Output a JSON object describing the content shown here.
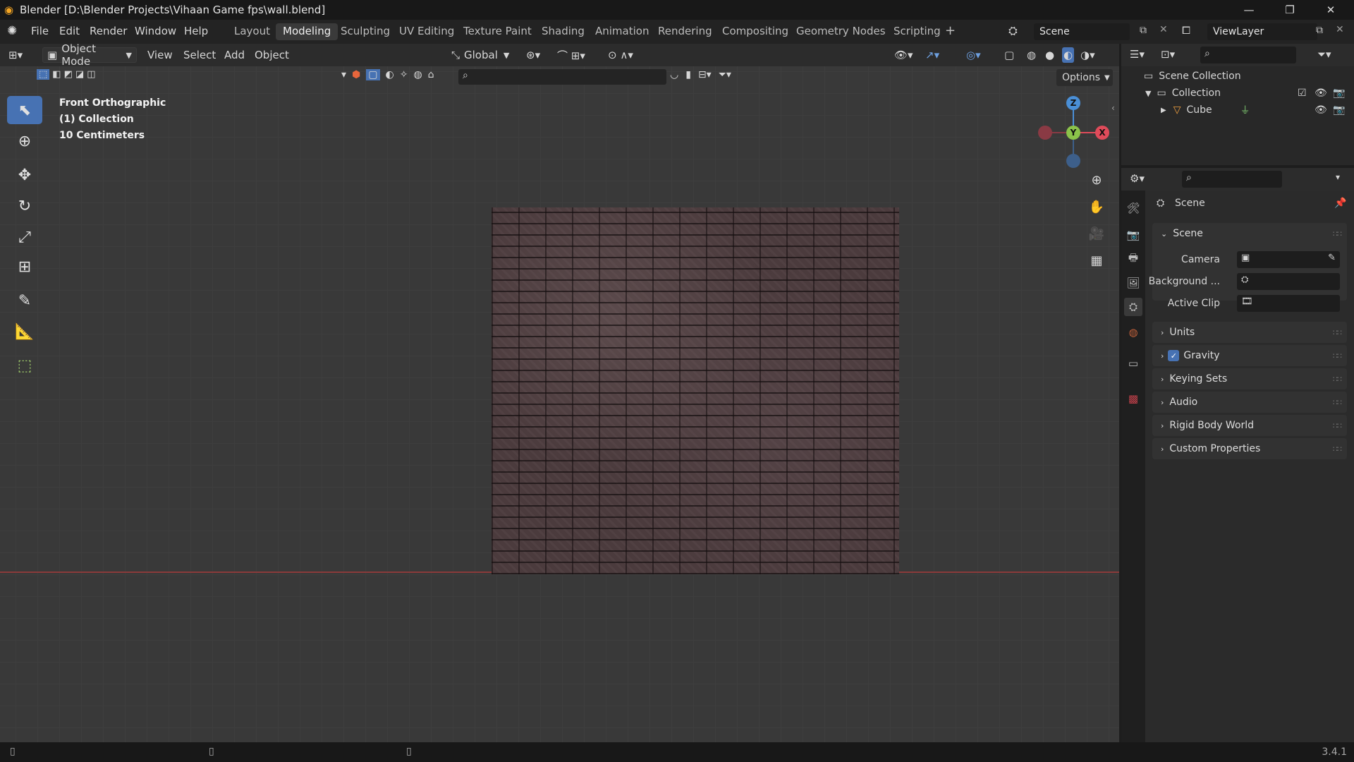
{
  "titlebar": {
    "title": "Blender [D:\\Blender Projects\\Vihaan Game fps\\wall.blend]",
    "minimize": "—",
    "maximize": "❐",
    "close": "✕"
  },
  "menus": [
    "File",
    "Edit",
    "Render",
    "Window",
    "Help"
  ],
  "workspaces": [
    "Layout",
    "Modeling",
    "Sculpting",
    "UV Editing",
    "Texture Paint",
    "Shading",
    "Animation",
    "Rendering",
    "Compositing",
    "Geometry Nodes",
    "Scripting"
  ],
  "workspace_active": "Modeling",
  "workspace_add": "+",
  "scene_field": "Scene",
  "viewlayer_field": "ViewLayer",
  "viewport_header": {
    "mode": "Object Mode",
    "menus": [
      "View",
      "Select",
      "Add",
      "Object"
    ],
    "orientation": "Global",
    "options": "Options"
  },
  "viewport_info": {
    "view": "Front Orthographic",
    "collection": "(1) Collection",
    "scale": "10 Centimeters"
  },
  "gizmo": {
    "z": "Z",
    "y": "Y",
    "x": "X"
  },
  "outliner": {
    "root": "Scene Collection",
    "collection": "Collection",
    "object": "Cube"
  },
  "properties": {
    "title": "Scene",
    "panel_scene": "Scene",
    "camera_label": "Camera",
    "background_label": "Background ...",
    "active_clip_label": "Active Clip",
    "sections": [
      "Units",
      "Gravity",
      "Keying Sets",
      "Audio",
      "Rigid Body World",
      "Custom Properties"
    ]
  },
  "statusbar": {
    "version": "3.4.1"
  },
  "colors": {
    "accent": "#4772b3",
    "x_axis": "#e04b5a",
    "y_axis": "#8bc34a",
    "z_axis": "#4a8fd6"
  },
  "icons": [
    "blender-logo-icon",
    "search-icon",
    "eye-icon",
    "camera-icon",
    "cube-icon",
    "mesh-icon",
    "scene-icon",
    "hand-icon",
    "zoom-icon",
    "grid-icon",
    "move-icon",
    "rotate-icon",
    "scale-icon",
    "cursor-icon",
    "annotate-icon",
    "measure-icon",
    "add-cube-icon"
  ]
}
